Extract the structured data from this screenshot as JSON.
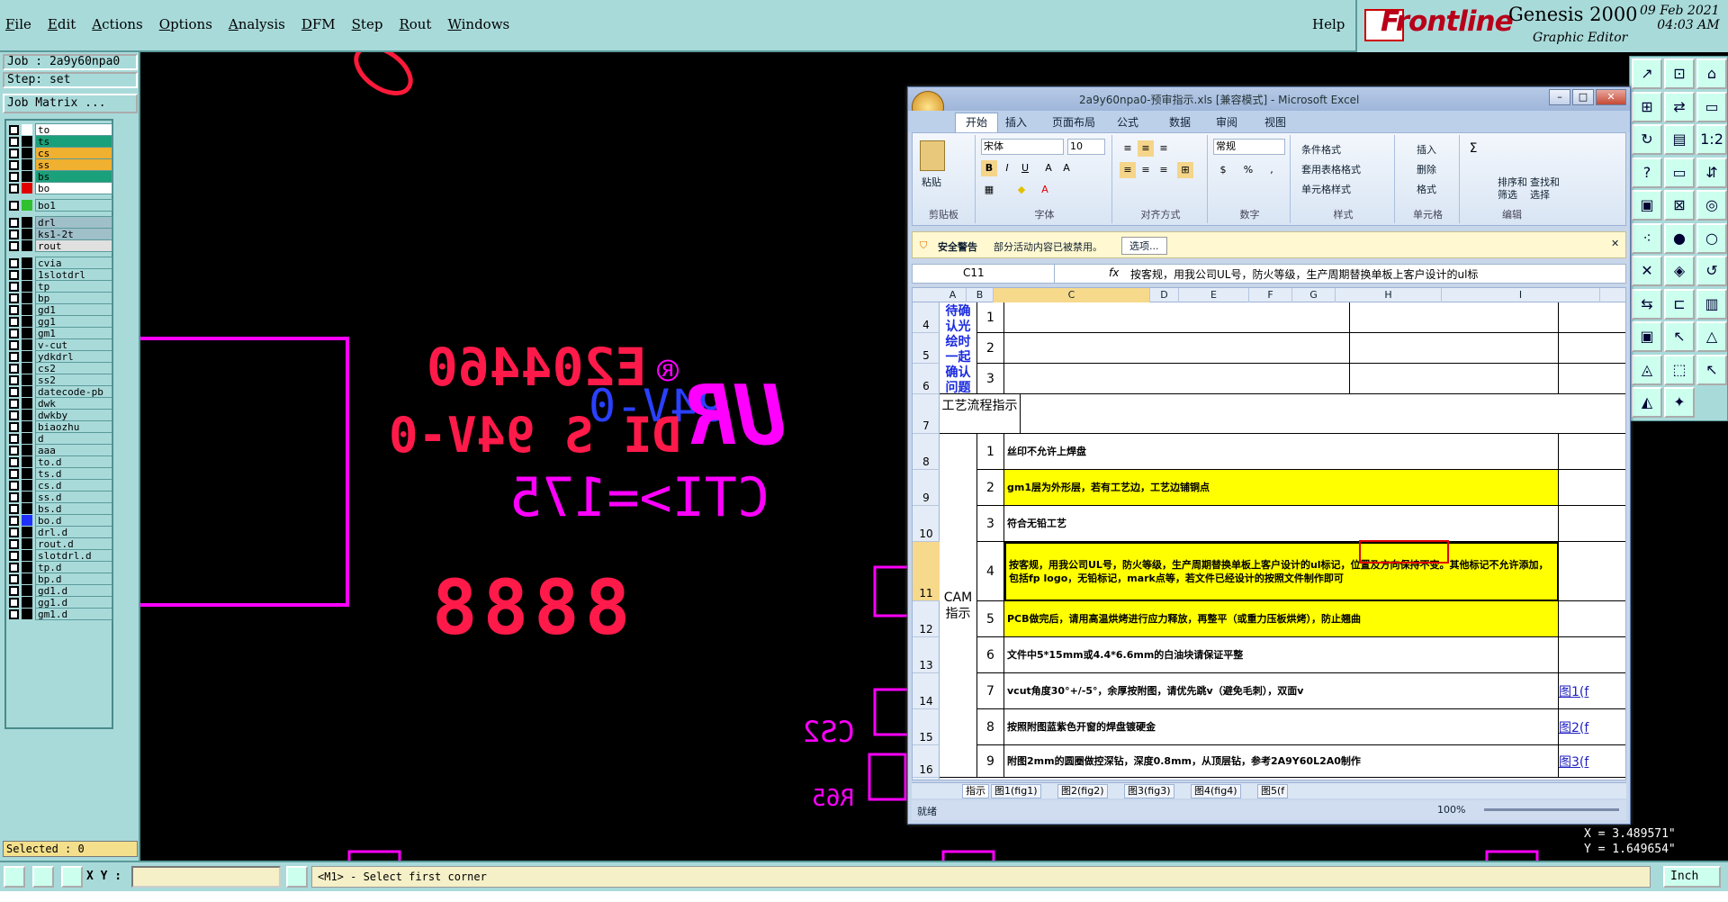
{
  "menubar": {
    "items": [
      "File",
      "Edit",
      "Actions",
      "Options",
      "Analysis",
      "DFM",
      "Step",
      "Rout",
      "Windows"
    ],
    "help": "Help"
  },
  "brand": {
    "logo": "Frontline",
    "product": "Genesis 2000",
    "subtitle": "Graphic Editor",
    "date": "09 Feb 2021",
    "time": "04:03 AM"
  },
  "job": {
    "job": "Job : 2a9y60npa0",
    "step": "Step: set",
    "matrix": "Job Matrix ..."
  },
  "layers": [
    {
      "name": "to",
      "color": "#ffffff",
      "field": "#ffffff"
    },
    {
      "name": "ts",
      "color": "#000000",
      "field": "#1aa07a"
    },
    {
      "name": "cs",
      "color": "#000000",
      "field": "#f0b030"
    },
    {
      "name": "ss",
      "color": "#000000",
      "field": "#f0b030"
    },
    {
      "name": "bs",
      "color": "#000000",
      "field": "#1aa07a"
    },
    {
      "name": "bo",
      "color": "#e00000",
      "field": "#ffffff"
    },
    {
      "name": "bo1",
      "color": "#30c030",
      "field": "#a9dada"
    },
    {
      "name": "drl",
      "color": "#000000",
      "field": "#9fbfc9"
    },
    {
      "name": "ks1-2t",
      "color": "#000000",
      "field": "#9fbfc9"
    },
    {
      "name": "rout",
      "color": "#000000",
      "field": "#e0e0e0"
    },
    {
      "name": "cvia",
      "color": "#000000",
      "field": "#a9dada"
    },
    {
      "name": "1slotdrl",
      "color": "#000000",
      "field": "#a9dada"
    },
    {
      "name": "tp",
      "color": "#000000",
      "field": "#a9dada"
    },
    {
      "name": "bp",
      "color": "#000000",
      "field": "#a9dada"
    },
    {
      "name": "gd1",
      "color": "#000000",
      "field": "#a9dada"
    },
    {
      "name": "gg1",
      "color": "#000000",
      "field": "#a9dada"
    },
    {
      "name": "gm1",
      "color": "#000000",
      "field": "#a9dada"
    },
    {
      "name": "v-cut",
      "color": "#000000",
      "field": "#a9dada"
    },
    {
      "name": "ydkdrl",
      "color": "#000000",
      "field": "#a9dada"
    },
    {
      "name": "cs2",
      "color": "#000000",
      "field": "#a9dada"
    },
    {
      "name": "ss2",
      "color": "#000000",
      "field": "#a9dada"
    },
    {
      "name": "datecode-pb",
      "color": "#000000",
      "field": "#a9dada"
    },
    {
      "name": "dwk",
      "color": "#000000",
      "field": "#a9dada"
    },
    {
      "name": "dwkby",
      "color": "#000000",
      "field": "#a9dada"
    },
    {
      "name": "biaozhu",
      "color": "#000000",
      "field": "#a9dada"
    },
    {
      "name": "d",
      "color": "#000000",
      "field": "#a9dada"
    },
    {
      "name": "aaa",
      "color": "#000000",
      "field": "#a9dada"
    },
    {
      "name": "to.d",
      "color": "#000000",
      "field": "#a9dada"
    },
    {
      "name": "ts.d",
      "color": "#000000",
      "field": "#a9dada"
    },
    {
      "name": "cs.d",
      "color": "#000000",
      "field": "#a9dada"
    },
    {
      "name": "ss.d",
      "color": "#000000",
      "field": "#a9dada"
    },
    {
      "name": "bs.d",
      "color": "#000000",
      "field": "#a9dada"
    },
    {
      "name": "bo.d",
      "color": "#2030ff",
      "field": "#a9dada"
    },
    {
      "name": "drl.d",
      "color": "#000000",
      "field": "#a9dada"
    },
    {
      "name": "rout.d",
      "color": "#000000",
      "field": "#a9dada"
    },
    {
      "name": "slotdrl.d",
      "color": "#000000",
      "field": "#a9dada"
    },
    {
      "name": "tp.d",
      "color": "#000000",
      "field": "#a9dada"
    },
    {
      "name": "bp.d",
      "color": "#000000",
      "field": "#a9dada"
    },
    {
      "name": "gd1.d",
      "color": "#000000",
      "field": "#a9dada"
    },
    {
      "name": "gg1.d",
      "color": "#000000",
      "field": "#a9dada"
    },
    {
      "name": "gm1.d",
      "color": "#000000",
      "field": "#a9dada"
    }
  ],
  "selected": "Selected : 0",
  "bottom": {
    "xy_label": "X Y :",
    "message": "<M1> - Select first corner",
    "unit": "Inch"
  },
  "coords": {
    "x": "X = 3.489571\"",
    "y": "Y = 1.649654\""
  },
  "cad": {
    "ul_code": "E204460",
    "mark94": "94V-0",
    "rating": "DI S 94V-0",
    "cti": "CTI>=175",
    "digits": "8888",
    "cs2": "CS2",
    "r65": "R65",
    "brand": "UR",
    "reg": "®"
  },
  "excel": {
    "title": "2a9y60npa0-预审指示.xls [兼容模式] - Microsoft Excel",
    "tabs": [
      "开始",
      "插入",
      "页面布局",
      "公式",
      "数据",
      "审阅",
      "视图"
    ],
    "ribbon": {
      "paste": "粘贴",
      "clipboard": "剪贴板",
      "font_name": "宋体",
      "font_size": "10",
      "font": "字体",
      "align": "对齐方式",
      "number_format": "常规",
      "number": "数字",
      "cond_fmt": "条件格式",
      "table_fmt": "套用表格格式",
      "cell_style": "单元格样式",
      "style": "样式",
      "insert": "插入",
      "delete": "删除",
      "format": "格式",
      "cells": "单元格",
      "sort": "排序和",
      "sort2": "筛选",
      "find": "查找和",
      "find2": "选择",
      "edit": "编辑",
      "sigma": "Σ",
      "pct": "%",
      "comma": ",",
      "dec1": ".00 →.0",
      "dec2": ".00 →.0",
      "fx": "fx"
    },
    "security": {
      "title": "安全警告",
      "text": "部分活动内容已被禁用。",
      "btn": "选项..."
    },
    "namebox": "C11",
    "formula": "按客规，用我公司UL号，防火等级，生产周期替换单板上客户设计的ul标",
    "columns": [
      "A",
      "B",
      "C",
      "D",
      "E",
      "F",
      "G",
      "H",
      "I"
    ],
    "rows": [
      "4",
      "5",
      "6",
      "7",
      "8",
      "9",
      "10",
      "11",
      "12",
      "13",
      "14",
      "15",
      "16"
    ],
    "confirm_label": "待确认光绘时一起确认问题",
    "flow_label": "工艺流程指示",
    "cam_label": "CAM指示",
    "items": [
      {
        "n": "1",
        "text": "丝印不允许上焊盘",
        "yel": false
      },
      {
        "n": "2",
        "text": "gm1层为外形层，若有工艺边，工艺边铺铜点",
        "yel": true
      },
      {
        "n": "3",
        "text": "符合无铅工艺",
        "yel": false
      },
      {
        "n": "4",
        "text": "按客规，用我公司UL号，防火等级，生产周期替换单板上客户设计的ul标记，位置及方向保持不变。其他标记不允许添加，包括fp logo，无铅标记，mark点等，若文件已经设计的按照文件制作即可",
        "yel": true
      },
      {
        "n": "5",
        "text": "PCB做完后，请用高温烘烤进行应力释放，再整平（或重力压板烘烤），防止翘曲",
        "yel": true
      },
      {
        "n": "6",
        "text": "文件中5*15mm或4.4*6.6mm的白油块请保证平整",
        "yel": false
      },
      {
        "n": "7",
        "text": "vcut角度30°+/-5°，余厚按附图，请优先跳v（避免毛刺），双面v",
        "yel": false
      },
      {
        "n": "8",
        "text": "按照附图蓝紫色开窗的焊盘镀硬金",
        "yel": false
      },
      {
        "n": "9",
        "text": "附图2mm的圆圈做控深钻，深度0.8mm，从顶层钻，参考2A9Y60L2A0制作",
        "yel": false
      }
    ],
    "confirm_nums": [
      "1",
      "2",
      "3"
    ],
    "links": [
      "图1(f",
      "图2(f",
      "图3(f"
    ],
    "sheets": [
      "指示",
      "图1(fig1)",
      "图2(fig2)",
      "图3(fig3)",
      "图4(fig4)",
      "图5(f"
    ],
    "status": "就绪",
    "zoom": "100%"
  }
}
